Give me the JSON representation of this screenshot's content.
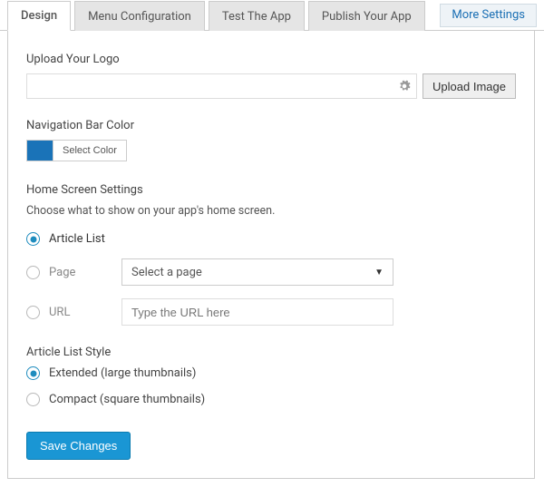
{
  "tabs": {
    "design": "Design",
    "menu": "Menu Configuration",
    "test": "Test The App",
    "publish": "Publish Your App",
    "more": "More Settings"
  },
  "logo": {
    "label": "Upload Your Logo",
    "button": "Upload Image"
  },
  "nav_color": {
    "label": "Navigation Bar Color",
    "button": "Select Color",
    "swatch": "#1a73b8"
  },
  "home": {
    "heading": "Home Screen Settings",
    "help": "Choose what to show on your app's home screen.",
    "options": {
      "article": "Article List",
      "page": "Page",
      "url": "URL"
    },
    "page_select": "Select a page",
    "url_placeholder": "Type the URL here"
  },
  "style": {
    "heading": "Article List Style",
    "extended": "Extended (large thumbnails)",
    "compact": "Compact (square thumbnails)"
  },
  "save": "Save Changes"
}
